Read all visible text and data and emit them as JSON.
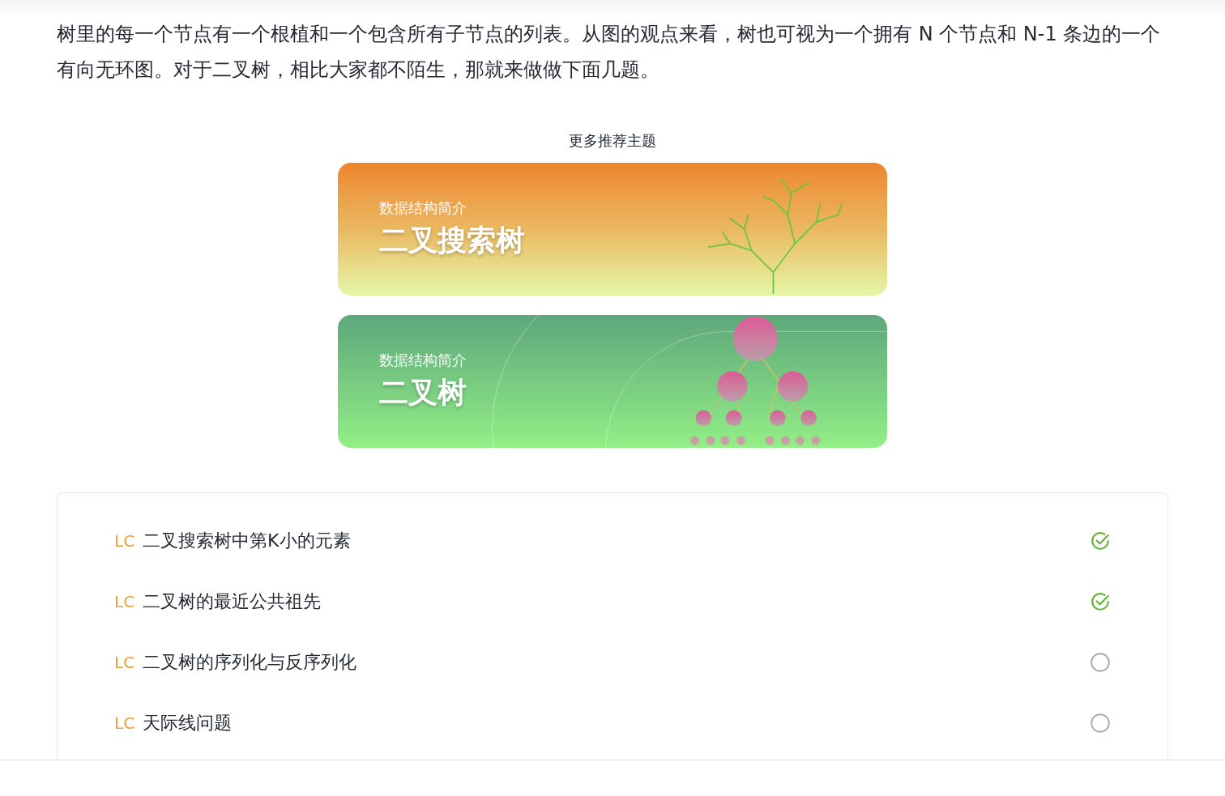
{
  "intro": "树里的每一个节点有一个根植和一个包含所有子节点的列表。从图的观点来看，树也可视为一个拥有 N 个节点和 N-1 条边的一个有向无环图。对于二叉树，相比大家都不陌生，那就来做做下面几题。",
  "topics": {
    "title": "更多推荐主题",
    "cards": [
      {
        "kind": "tree",
        "subtitle": "数据结构简介",
        "title": "二叉搜索树"
      },
      {
        "kind": "nodes",
        "subtitle": "数据结构简介",
        "title": "二叉树"
      }
    ]
  },
  "problems": [
    {
      "tag": "LC",
      "title": "二叉搜索树中第K小的元素",
      "checked": true
    },
    {
      "tag": "LC",
      "title": "二叉树的最近公共祖先",
      "checked": true
    },
    {
      "tag": "LC",
      "title": "二叉树的序列化与反序列化",
      "checked": false
    },
    {
      "tag": "LC",
      "title": "天际线问题",
      "checked": false
    }
  ]
}
